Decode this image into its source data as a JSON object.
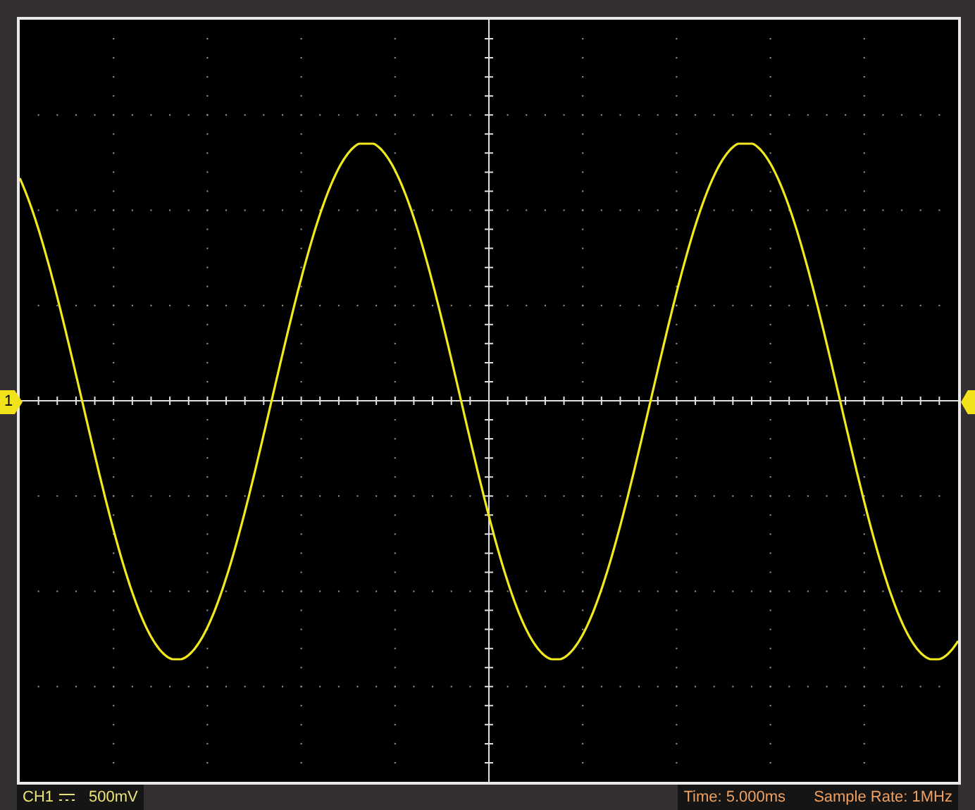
{
  "screen": {
    "channel_markers": [
      {
        "label": "1",
        "kind": "left"
      },
      {
        "kind": "right"
      }
    ]
  },
  "status_bar": {
    "channel": "CH1",
    "scale": "500mV",
    "time": "Time: 5.000ms",
    "sample_rate": "Sample Rate: 1MHz"
  }
}
